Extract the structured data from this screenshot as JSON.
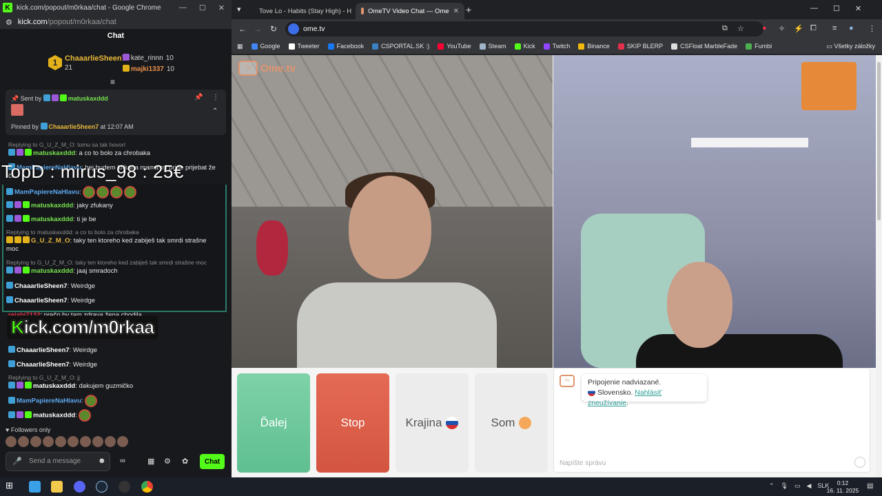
{
  "kick": {
    "window_title": "kick.com/popout/m0rkaa/chat - Google Chrome",
    "url_host": "kick.com",
    "url_path": "/popout/m0rkaa/chat",
    "chat_title": "Chat",
    "leaderboard": {
      "rank": "1",
      "top_name": "ChaaarlieSheen7",
      "top_count": "21",
      "second_name": "kate_rinnn",
      "second_count": "10",
      "third_name": "majki1337",
      "third_count": "10"
    },
    "pinned": {
      "sent_by_label": "Sent by",
      "sent_by_user": "matuskaxddd",
      "pinned_by_label": "Pinned by",
      "pinned_by_user": "ChaaarlieSheen7",
      "pinned_at": "at 12:07 AM"
    },
    "messages": [
      {
        "reply": "Replying to G_U_Z_M_O: tomu sa tak hovorí",
        "user": "matuskaxddd",
        "text": ": a co to bolo za chrobaka"
      },
      {
        "user": "MamPapiereNaHlavu",
        "text": ": hej budem krikat a mama mi pride prijebat že či"
      },
      {
        "user": "MamPapiereNaHlavu",
        "text": ":"
      },
      {
        "user": "matuskaxddd",
        "text": ": jaky zfukany"
      },
      {
        "user": "matuskaxddd",
        "text": ": ti je be"
      },
      {
        "reply": "Replying to matuskaxddd: a co to bolo za chrobaka",
        "user": "G_U_Z_M_O",
        "text": ": taky ten ktoreho ked zabiješ tak smrdi strašne moc"
      },
      {
        "reply": "Replying to G_U_Z_M_O: taky ten ktoreho ked zabiješ tak smrdi strašne moc",
        "user": "matuskaxddd",
        "text": ": jaaj smradoch"
      },
      {
        "user": "ChaaarlieSheen7",
        "text": ": Weirdge"
      },
      {
        "user": "ChaaarlieSheen7",
        "text": ": Weirdge"
      },
      {
        "user": "rejabi7132",
        "text": ": prečo by tam zdrava žena chodila"
      },
      {
        "user": "ChaaarlieSheen7",
        "text": ": Weirdge"
      },
      {
        "user": "ChaaarlieSheen7",
        "text": ": Weirdge"
      },
      {
        "reply": "Replying to G_U_Z_M_O: jj",
        "user": "matuskaxddd",
        "text": ": dakujem guzmičko"
      },
      {
        "user": "MamPapiereNaHlavu",
        "text": ":"
      },
      {
        "user": "matuskaxddd",
        "text": ":"
      }
    ],
    "overlay_top": "TopD : mirus_98 : 25€",
    "overlay_logo_k": "K",
    "overlay_logo_rest": "ick.com/m0rkaa",
    "followers_only": "Followers only",
    "composer_placeholder": "Send a message",
    "chat_button": "Chat"
  },
  "chrome": {
    "tabs": [
      {
        "label": "Tove Lo - Habits (Stay High) - H",
        "fav_color": "#ff0033"
      },
      {
        "label": "OmeTV Video Chat — Ome",
        "fav_color": "#e0956e"
      }
    ],
    "url": "ome.tv",
    "bookmarks": [
      {
        "label": "Google",
        "color": "#4285f4"
      },
      {
        "label": "Tweeter",
        "color": "#ffffff"
      },
      {
        "label": "Facebook",
        "color": "#1877f2"
      },
      {
        "label": "CSPORTAL.SK :)",
        "color": "#3b82c4"
      },
      {
        "label": "YouTube",
        "color": "#ff0033"
      },
      {
        "label": "Steam",
        "color": "#9fb4c9"
      },
      {
        "label": "Kick",
        "color": "#53fc18"
      },
      {
        "label": "Twitch",
        "color": "#9146ff"
      },
      {
        "label": "Binance",
        "color": "#f0b90b"
      },
      {
        "label": "SKIP BLERP",
        "color": "#e3304b"
      },
      {
        "label": "CSFloat MarbleFade",
        "color": "#dddddd"
      },
      {
        "label": "Fumbi",
        "color": "#4caf50"
      }
    ],
    "all_bookmarks": "Všetky záložky"
  },
  "ometv": {
    "logo_text": "Ome.tv",
    "buttons": {
      "next": "Ďalej",
      "stop": "Stop",
      "country": "Krajina",
      "me": "Som"
    },
    "connection_text": "Pripojenie nadviazané.",
    "country_name": "Slovensko.",
    "report_link": "Nahlásiť zneužívanie",
    "message_placeholder": "Napíšte správu"
  },
  "taskbar": {
    "lang": "SLK",
    "time": "0:12",
    "date": "16. 11. 2025"
  }
}
